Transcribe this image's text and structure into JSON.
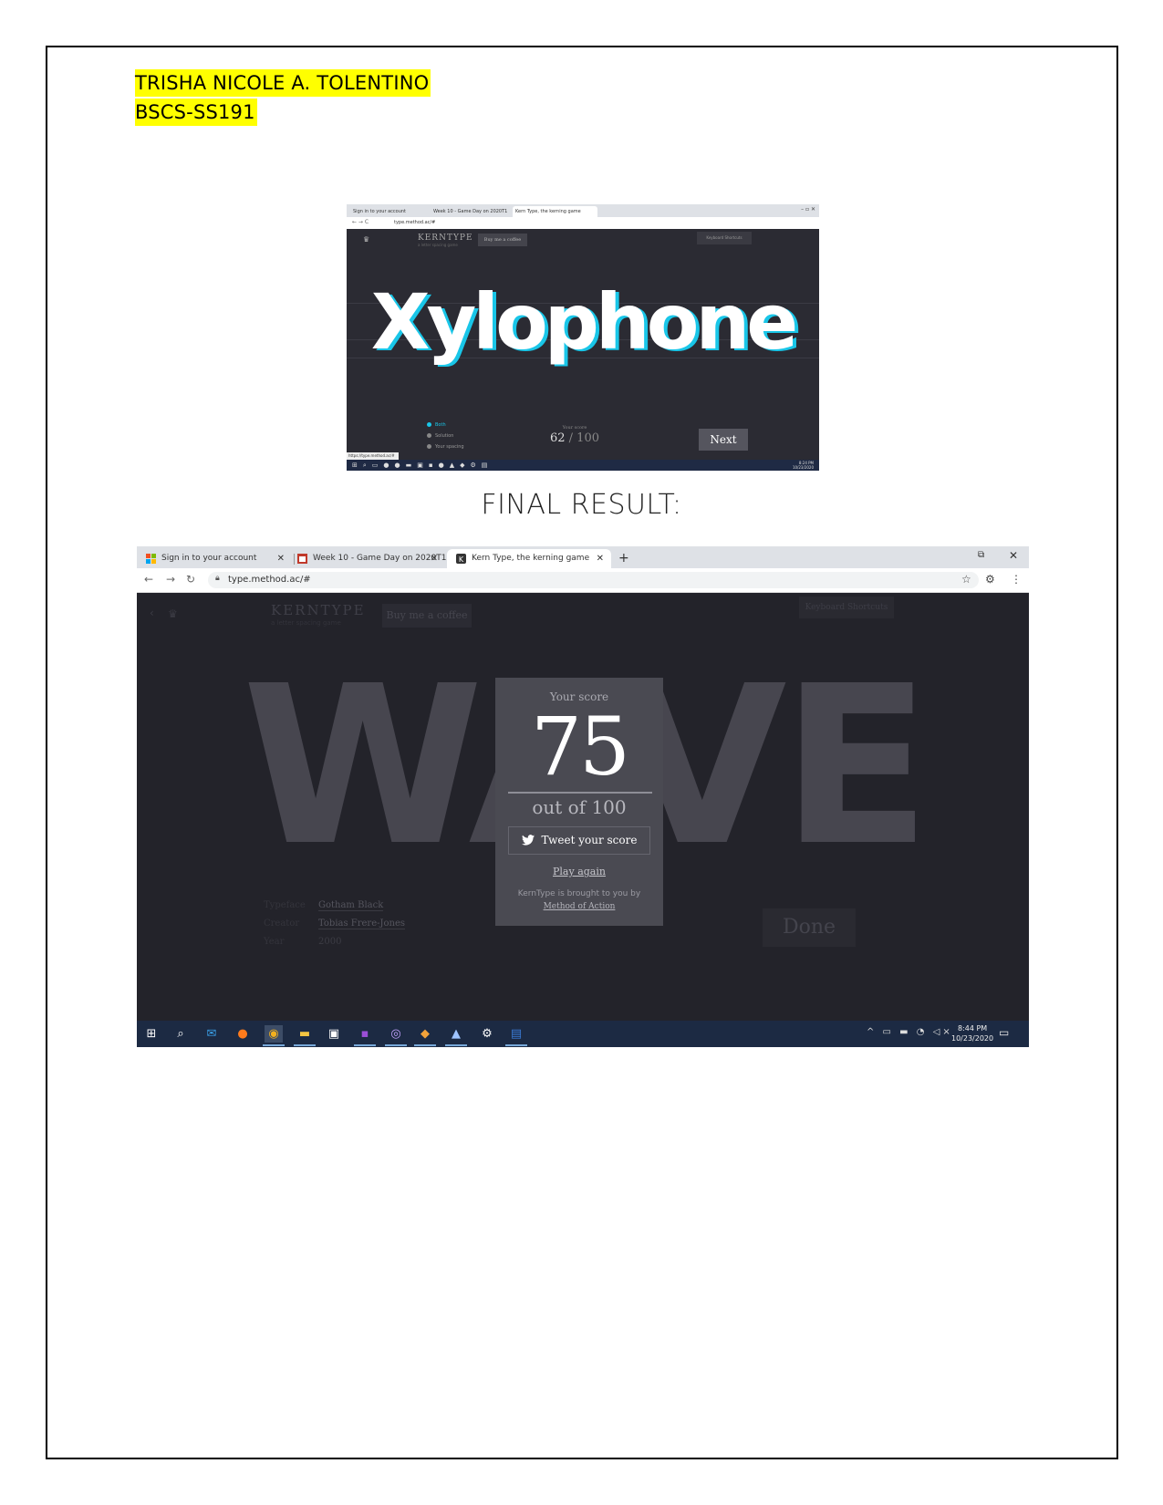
{
  "header": {
    "name": "TRISHA NICOLE A. TOLENTINO",
    "section": "BSCS-SS191"
  },
  "screenshot1": {
    "tabs": [
      "Sign in to your account",
      "Week 10 - Game Day on 2020T1",
      "Kern Type, the kerning game"
    ],
    "url": "type.method.ac/#",
    "logo": "KERNTYPE",
    "logo_sub": "a letter spacing game",
    "coffee": "Buy me a coffee",
    "shortcuts": "Keyboard Shortcuts",
    "word": "Xylophone",
    "options": [
      "Both",
      "Solution",
      "Your spacing"
    ],
    "score_label": "Your score",
    "score": "62",
    "score_total": "/ 100",
    "next_label": "Next",
    "status_url": "https://type.method.ac/#",
    "clock_time": "8:24 PM",
    "clock_date": "10/23/2020"
  },
  "final_result_label": "FINAL RESULT:",
  "screenshot2": {
    "tabs": [
      {
        "label": "Sign in to your account",
        "icon": "microsoft-icon"
      },
      {
        "label": "Week 10 - Game Day on 2020T1",
        "icon": "course-icon"
      },
      {
        "label": "Kern Type, the kerning game",
        "icon": "k-icon"
      }
    ],
    "url": "type.method.ac/#",
    "logo": "KERNTYPE",
    "logo_sub": "a letter spacing game",
    "coffee": "Buy me a coffee",
    "shortcuts": "Keyboard Shortcuts",
    "word": "WAVE",
    "score_label": "Your score",
    "score": "75",
    "out_of": "out of 100",
    "tweet": "Tweet your score",
    "play_again": "Play again",
    "credit_prefix": "KernType is brought to you by",
    "credit_link": "Method of Action",
    "meta": {
      "typeface_label": "Typeface",
      "typeface": "Gotham Black",
      "creator_label": "Creator",
      "creator": "Tobias Frere-Jones",
      "year_label": "Year",
      "year": "2000"
    },
    "done_label": "Done",
    "clock_time": "8:44 PM",
    "clock_date": "10/23/2020"
  }
}
